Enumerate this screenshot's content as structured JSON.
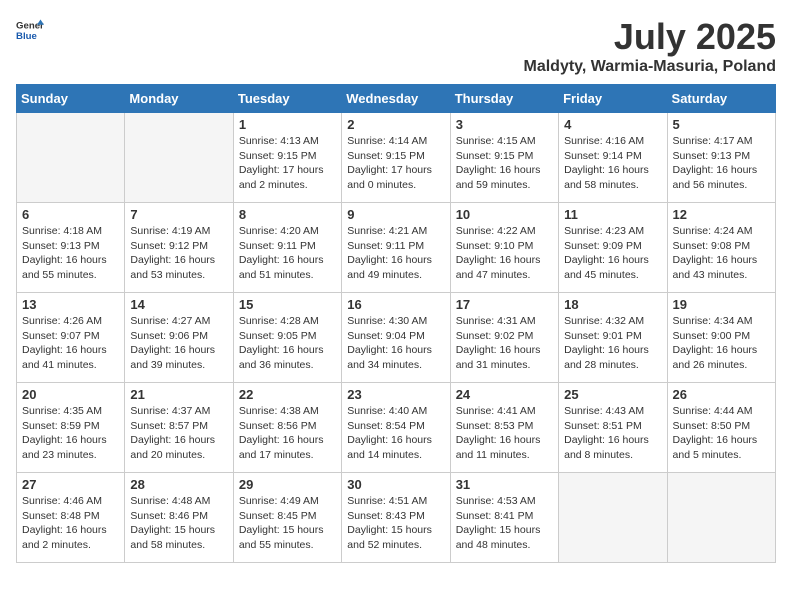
{
  "logo": {
    "text_general": "General",
    "text_blue": "Blue"
  },
  "title": "July 2025",
  "subtitle": "Maldyty, Warmia-Masuria, Poland",
  "days_of_week": [
    "Sunday",
    "Monday",
    "Tuesday",
    "Wednesday",
    "Thursday",
    "Friday",
    "Saturday"
  ],
  "weeks": [
    [
      {
        "day": "",
        "info": ""
      },
      {
        "day": "",
        "info": ""
      },
      {
        "day": "1",
        "info": "Sunrise: 4:13 AM\nSunset: 9:15 PM\nDaylight: 17 hours and 2 minutes."
      },
      {
        "day": "2",
        "info": "Sunrise: 4:14 AM\nSunset: 9:15 PM\nDaylight: 17 hours and 0 minutes."
      },
      {
        "day": "3",
        "info": "Sunrise: 4:15 AM\nSunset: 9:15 PM\nDaylight: 16 hours and 59 minutes."
      },
      {
        "day": "4",
        "info": "Sunrise: 4:16 AM\nSunset: 9:14 PM\nDaylight: 16 hours and 58 minutes."
      },
      {
        "day": "5",
        "info": "Sunrise: 4:17 AM\nSunset: 9:13 PM\nDaylight: 16 hours and 56 minutes."
      }
    ],
    [
      {
        "day": "6",
        "info": "Sunrise: 4:18 AM\nSunset: 9:13 PM\nDaylight: 16 hours and 55 minutes."
      },
      {
        "day": "7",
        "info": "Sunrise: 4:19 AM\nSunset: 9:12 PM\nDaylight: 16 hours and 53 minutes."
      },
      {
        "day": "8",
        "info": "Sunrise: 4:20 AM\nSunset: 9:11 PM\nDaylight: 16 hours and 51 minutes."
      },
      {
        "day": "9",
        "info": "Sunrise: 4:21 AM\nSunset: 9:11 PM\nDaylight: 16 hours and 49 minutes."
      },
      {
        "day": "10",
        "info": "Sunrise: 4:22 AM\nSunset: 9:10 PM\nDaylight: 16 hours and 47 minutes."
      },
      {
        "day": "11",
        "info": "Sunrise: 4:23 AM\nSunset: 9:09 PM\nDaylight: 16 hours and 45 minutes."
      },
      {
        "day": "12",
        "info": "Sunrise: 4:24 AM\nSunset: 9:08 PM\nDaylight: 16 hours and 43 minutes."
      }
    ],
    [
      {
        "day": "13",
        "info": "Sunrise: 4:26 AM\nSunset: 9:07 PM\nDaylight: 16 hours and 41 minutes."
      },
      {
        "day": "14",
        "info": "Sunrise: 4:27 AM\nSunset: 9:06 PM\nDaylight: 16 hours and 39 minutes."
      },
      {
        "day": "15",
        "info": "Sunrise: 4:28 AM\nSunset: 9:05 PM\nDaylight: 16 hours and 36 minutes."
      },
      {
        "day": "16",
        "info": "Sunrise: 4:30 AM\nSunset: 9:04 PM\nDaylight: 16 hours and 34 minutes."
      },
      {
        "day": "17",
        "info": "Sunrise: 4:31 AM\nSunset: 9:02 PM\nDaylight: 16 hours and 31 minutes."
      },
      {
        "day": "18",
        "info": "Sunrise: 4:32 AM\nSunset: 9:01 PM\nDaylight: 16 hours and 28 minutes."
      },
      {
        "day": "19",
        "info": "Sunrise: 4:34 AM\nSunset: 9:00 PM\nDaylight: 16 hours and 26 minutes."
      }
    ],
    [
      {
        "day": "20",
        "info": "Sunrise: 4:35 AM\nSunset: 8:59 PM\nDaylight: 16 hours and 23 minutes."
      },
      {
        "day": "21",
        "info": "Sunrise: 4:37 AM\nSunset: 8:57 PM\nDaylight: 16 hours and 20 minutes."
      },
      {
        "day": "22",
        "info": "Sunrise: 4:38 AM\nSunset: 8:56 PM\nDaylight: 16 hours and 17 minutes."
      },
      {
        "day": "23",
        "info": "Sunrise: 4:40 AM\nSunset: 8:54 PM\nDaylight: 16 hours and 14 minutes."
      },
      {
        "day": "24",
        "info": "Sunrise: 4:41 AM\nSunset: 8:53 PM\nDaylight: 16 hours and 11 minutes."
      },
      {
        "day": "25",
        "info": "Sunrise: 4:43 AM\nSunset: 8:51 PM\nDaylight: 16 hours and 8 minutes."
      },
      {
        "day": "26",
        "info": "Sunrise: 4:44 AM\nSunset: 8:50 PM\nDaylight: 16 hours and 5 minutes."
      }
    ],
    [
      {
        "day": "27",
        "info": "Sunrise: 4:46 AM\nSunset: 8:48 PM\nDaylight: 16 hours and 2 minutes."
      },
      {
        "day": "28",
        "info": "Sunrise: 4:48 AM\nSunset: 8:46 PM\nDaylight: 15 hours and 58 minutes."
      },
      {
        "day": "29",
        "info": "Sunrise: 4:49 AM\nSunset: 8:45 PM\nDaylight: 15 hours and 55 minutes."
      },
      {
        "day": "30",
        "info": "Sunrise: 4:51 AM\nSunset: 8:43 PM\nDaylight: 15 hours and 52 minutes."
      },
      {
        "day": "31",
        "info": "Sunrise: 4:53 AM\nSunset: 8:41 PM\nDaylight: 15 hours and 48 minutes."
      },
      {
        "day": "",
        "info": ""
      },
      {
        "day": "",
        "info": ""
      }
    ]
  ]
}
